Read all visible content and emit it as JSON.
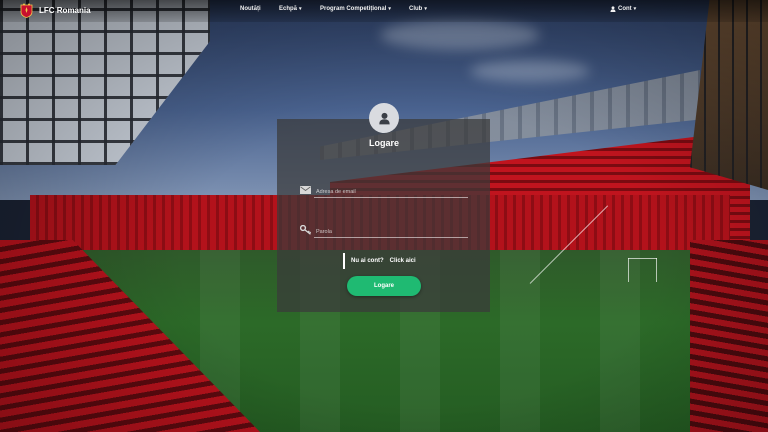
{
  "brand": {
    "name": "LFC Romania"
  },
  "nav": {
    "items": [
      {
        "label": "Noutăți",
        "has_dropdown": false
      },
      {
        "label": "Echpă",
        "has_dropdown": true
      },
      {
        "label": "Program Competițional",
        "has_dropdown": true
      },
      {
        "label": "Club",
        "has_dropdown": true
      }
    ],
    "account": {
      "label": "Cont",
      "has_dropdown": true,
      "icon": "user-icon"
    }
  },
  "login": {
    "title": "Logare",
    "avatar_icon": "user-icon",
    "email": {
      "icon": "envelope-icon",
      "placeholder": "Adresa de email",
      "value": ""
    },
    "password": {
      "icon": "key-icon",
      "placeholder": "Parola",
      "value": ""
    },
    "signup_question": "Nu ai cont?",
    "signup_link": "Click aici",
    "submit_label": "Logare"
  },
  "colors": {
    "accent_button": "#1fba72",
    "panel_bg": "rgba(58,58,58,0.72)",
    "brand_red": "#c8102e"
  }
}
